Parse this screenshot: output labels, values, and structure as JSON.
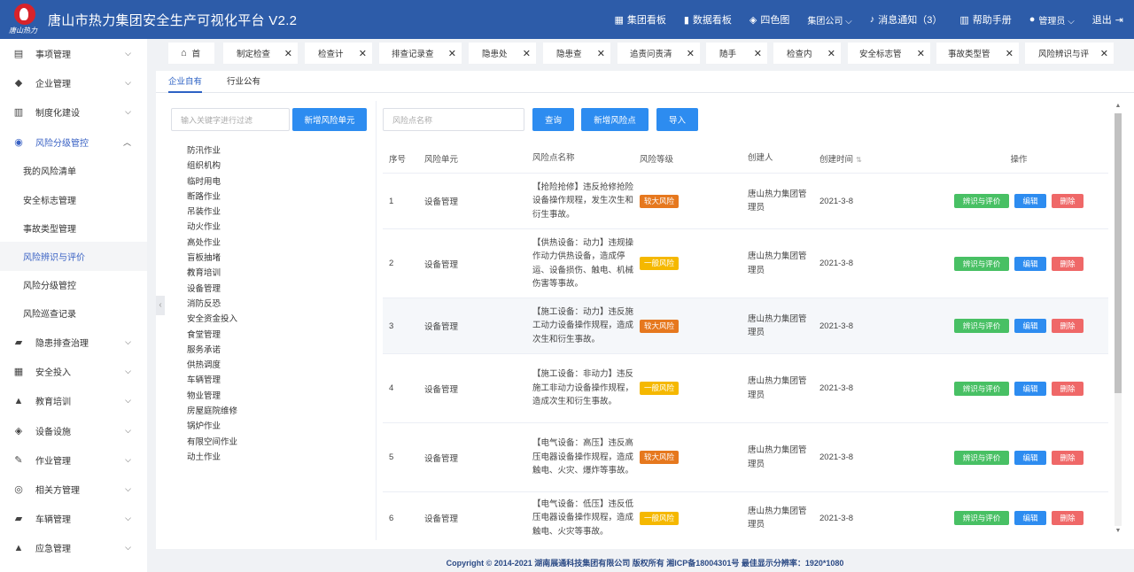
{
  "header": {
    "title": "唐山市热力集团安全生产可视化平台  V2.2",
    "logo_text": "唐山热力",
    "nav": [
      {
        "icon": "map-icon",
        "glyph": "▦",
        "label": "集团看板"
      },
      {
        "icon": "chart-icon",
        "glyph": "▮",
        "label": "数据看板"
      },
      {
        "icon": "cube-icon",
        "glyph": "◈",
        "label": "四色图"
      },
      {
        "icon": "",
        "glyph": "",
        "label": "集团公司 ⌵"
      },
      {
        "icon": "bell-icon",
        "glyph": "♪",
        "label": "消息通知（3）"
      },
      {
        "icon": "book-icon",
        "glyph": "▥",
        "label": "帮助手册"
      },
      {
        "icon": "user-icon",
        "glyph": "●",
        "label": "管理员 ⌵"
      },
      {
        "icon": "logout-icon",
        "glyph": "⇥",
        "label": "退出"
      }
    ]
  },
  "sidebar": {
    "items": [
      {
        "label": "事项管理",
        "glyph": "▤",
        "icon": "document-icon"
      },
      {
        "label": "企业管理",
        "glyph": "◆",
        "icon": "building-icon"
      },
      {
        "label": "制度化建设",
        "glyph": "▥",
        "icon": "institution-icon"
      },
      {
        "label": "风险分级管控",
        "glyph": "◉",
        "icon": "risk-icon"
      },
      {
        "label": "隐患排查治理",
        "glyph": "▰",
        "icon": "truck-icon"
      },
      {
        "label": "安全投入",
        "glyph": "▦",
        "icon": "calculator-icon"
      },
      {
        "label": "教育培训",
        "glyph": "▲",
        "icon": "graduation-icon"
      },
      {
        "label": "设备设施",
        "glyph": "◈",
        "icon": "box-icon"
      },
      {
        "label": "作业管理",
        "glyph": "✎",
        "icon": "wrench-icon"
      },
      {
        "label": "相关方管理",
        "glyph": "◎",
        "icon": "person-icon"
      },
      {
        "label": "车辆管理",
        "glyph": "▰",
        "icon": "vehicle-icon"
      },
      {
        "label": "应急管理",
        "glyph": "▲",
        "icon": "emergency-icon"
      }
    ],
    "sub_items": [
      "我的风险清单",
      "安全标志管理",
      "事故类型管理",
      "风险辨识与评价",
      "风险分级管控",
      "风险巡查记录"
    ]
  },
  "tabs": [
    "首",
    "制定检查",
    "检查计",
    "排查记录查",
    "隐患处",
    "隐患查",
    "追责问责清",
    "随手",
    "检查内",
    "安全标志管",
    "事故类型管",
    "风险辨识与评"
  ],
  "subtabs": [
    "企业自有",
    "行业公有"
  ],
  "left_panel": {
    "filter_placeholder": "输入关键字进行过滤",
    "new_unit_button": "新增风险单元",
    "tree": [
      "防汛作业",
      "组织机构",
      "临时用电",
      "断路作业",
      "吊装作业",
      "动火作业",
      "高处作业",
      "盲板抽堵",
      "教育培训",
      "设备管理",
      "消防反恐",
      "安全资金投入",
      "食堂管理",
      "服务承诺",
      "供热调度",
      "车辆管理",
      "物业管理",
      "房屋庭院维修",
      "锅炉作业",
      "有限空间作业",
      "动土作业"
    ]
  },
  "toolbar": {
    "search_placeholder": "风险点名称",
    "query": "查询",
    "add": "新增风险点",
    "import": "导入"
  },
  "table": {
    "columns": [
      "序号",
      "风险单元",
      "风险点名称",
      "风险等级",
      "创建人",
      "创建时间",
      "操作"
    ],
    "op_labels": [
      "辨识与评价",
      "编辑",
      "删除"
    ],
    "rows": [
      {
        "no": "1",
        "unit": "设备管理",
        "name": "【抢险抢修】违反抢修抢险设备操作规程，发生次生和衍生事故。",
        "level": "较大风险",
        "level_color": "orange",
        "creator": "唐山热力集团管理员",
        "time": "2021-3-8"
      },
      {
        "no": "2",
        "unit": "设备管理",
        "name": "【供热设备：动力】违规操作动力供热设备，造成停运、设备损伤、触电、机械伤害等事故。",
        "level": "一般风险",
        "level_color": "yellow",
        "creator": "唐山热力集团管理员",
        "time": "2021-3-8"
      },
      {
        "no": "3",
        "unit": "设备管理",
        "name": "【施工设备：动力】违反施工动力设备操作规程，造成次生和衍生事故。",
        "level": "较大风险",
        "level_color": "orange",
        "creator": "唐山热力集团管理员",
        "time": "2021-3-8"
      },
      {
        "no": "4",
        "unit": "设备管理",
        "name": "【施工设备：非动力】违反施工非动力设备操作规程，造成次生和衍生事故。",
        "level": "一般风险",
        "level_color": "yellow",
        "creator": "唐山热力集团管理员",
        "time": "2021-3-8"
      },
      {
        "no": "5",
        "unit": "设备管理",
        "name": "【电气设备：高压】违反高压电器设备操作规程，造成触电、火灾、爆炸等事故。",
        "level": "较大风险",
        "level_color": "orange",
        "creator": "唐山热力集团管理员",
        "time": "2021-3-8"
      },
      {
        "no": "6",
        "unit": "设备管理",
        "name": "【电气设备：低压】违反低压电器设备操作规程，造成触电、火灾等事故。",
        "level": "一般风险",
        "level_color": "yellow",
        "creator": "唐山热力集团管理员",
        "time": "2021-3-8"
      }
    ]
  },
  "footer": "Copyright © 2014-2021 湖南展通科技集团有限公司 版权所有 湘ICP备18004301号 最佳显示分辨率：1920*1080",
  "colors": {
    "header_bg": "#2d5ca9",
    "primary": "#2d8cf0",
    "success": "#48c064",
    "danger": "#ef6868",
    "warning_orange": "#e6781e",
    "warning_yellow": "#f5b800"
  }
}
